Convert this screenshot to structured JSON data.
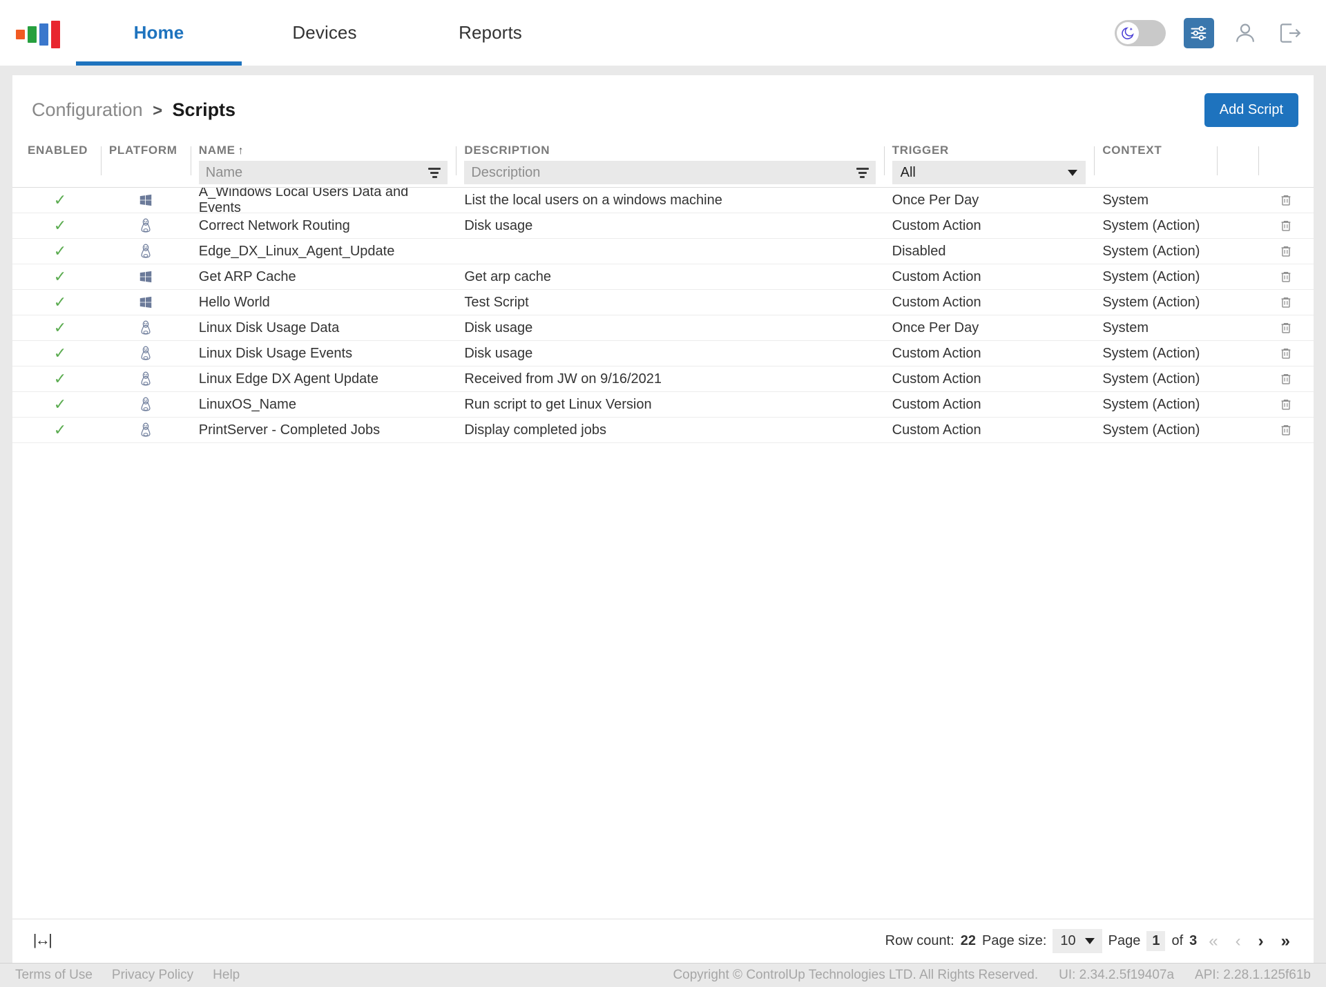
{
  "header": {
    "logo_name": "controlup-logo",
    "nav": [
      {
        "label": "Home",
        "active": true
      },
      {
        "label": "Devices",
        "active": false
      },
      {
        "label": "Reports",
        "active": false
      }
    ],
    "dark_mode_toggle": "dark-mode-toggle",
    "settings_label": "Settings",
    "account_label": "Account",
    "logout_label": "Log out"
  },
  "breadcrumb": {
    "parent": "Configuration",
    "separator": ">",
    "current": "Scripts"
  },
  "actions": {
    "add_script": "Add Script"
  },
  "table": {
    "columns": [
      {
        "key": "enabled",
        "label": "ENABLED"
      },
      {
        "key": "platform",
        "label": "PLATFORM"
      },
      {
        "key": "name",
        "label": "NAME",
        "sort": "asc",
        "sort_glyph": "↑"
      },
      {
        "key": "description",
        "label": "DESCRIPTION"
      },
      {
        "key": "trigger",
        "label": "TRIGGER"
      },
      {
        "key": "context",
        "label": "CONTEXT"
      }
    ],
    "filters": {
      "name_placeholder": "Name",
      "name_value": "",
      "description_placeholder": "Description",
      "description_value": "",
      "trigger_selected": "All"
    },
    "rows": [
      {
        "enabled": "✓",
        "platform": "windows",
        "name": "A_Windows Local Users Data and Events",
        "description": "List the local users on a windows machine",
        "trigger": "Once Per Day",
        "context": "System"
      },
      {
        "enabled": "✓",
        "platform": "linux",
        "name": "Correct Network Routing",
        "description": "Disk usage",
        "trigger": "Custom Action",
        "context": "System (Action)"
      },
      {
        "enabled": "✓",
        "platform": "linux",
        "name": "Edge_DX_Linux_Agent_Update",
        "description": "",
        "trigger": "Disabled",
        "context": "System (Action)"
      },
      {
        "enabled": "✓",
        "platform": "windows",
        "name": "Get ARP Cache",
        "description": "Get arp cache",
        "trigger": "Custom Action",
        "context": "System (Action)"
      },
      {
        "enabled": "✓",
        "platform": "windows",
        "name": "Hello World",
        "description": "Test Script",
        "trigger": "Custom Action",
        "context": "System (Action)"
      },
      {
        "enabled": "✓",
        "platform": "linux",
        "name": "Linux Disk Usage Data",
        "description": "Disk usage",
        "trigger": "Once Per Day",
        "context": "System"
      },
      {
        "enabled": "✓",
        "platform": "linux",
        "name": "Linux Disk Usage Events",
        "description": "Disk usage",
        "trigger": "Custom Action",
        "context": "System (Action)"
      },
      {
        "enabled": "✓",
        "platform": "linux",
        "name": "Linux Edge DX Agent Update",
        "description": "Received from JW on 9/16/2021",
        "trigger": "Custom Action",
        "context": "System (Action)"
      },
      {
        "enabled": "✓",
        "platform": "linux",
        "name": "LinuxOS_Name",
        "description": "Run script to get Linux Version",
        "trigger": "Custom Action",
        "context": "System (Action)"
      },
      {
        "enabled": "✓",
        "platform": "linux",
        "name": "PrintServer - Completed Jobs",
        "description": "Display completed jobs",
        "trigger": "Custom Action",
        "context": "System (Action)"
      }
    ]
  },
  "grid_footer": {
    "fit_columns_glyph": "|↔|",
    "row_count_label": "Row count:",
    "row_count_value": "22",
    "page_size_label": "Page size:",
    "page_size_value": "10",
    "page_label": "Page",
    "page_value": "1",
    "of_label": "of",
    "total_pages": "3",
    "first_glyph": "«",
    "prev_glyph": "‹",
    "next_glyph": "›",
    "last_glyph": "»"
  },
  "footer": {
    "terms": "Terms of Use",
    "privacy": "Privacy Policy",
    "help": "Help",
    "copyright": "Copyright © ControlUp Technologies LTD. All Rights Reserved.",
    "ui_version": "UI: 2.34.2.5f19407a",
    "api_version": "API: 2.28.1.125f61b"
  },
  "colors": {
    "accent": "#1e73be",
    "check": "#5aab4f",
    "platform_icon": "#6b7a99",
    "logo": [
      "#f15a22",
      "#27a03f",
      "#3a77cc",
      "#e8262f"
    ]
  }
}
